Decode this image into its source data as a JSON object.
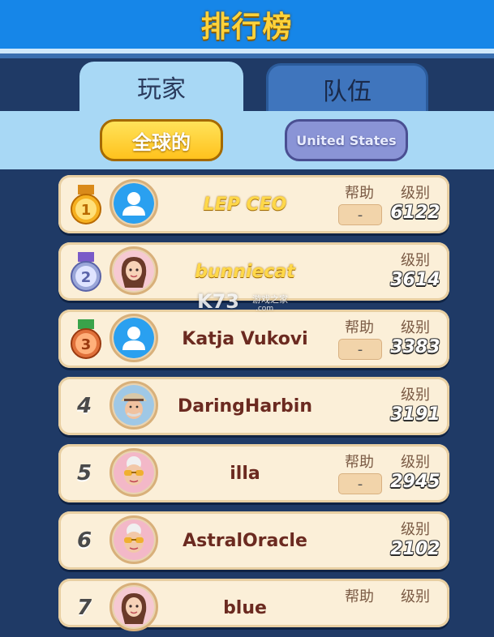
{
  "header": {
    "title": "排行榜"
  },
  "tabs": [
    {
      "label": "玩家",
      "active": true
    },
    {
      "label": "队伍",
      "active": false
    }
  ],
  "filters": {
    "global_label": "全球的",
    "country_label": "United States"
  },
  "columns": {
    "help": "帮助",
    "level": "级别"
  },
  "rows": [
    {
      "rank": "1",
      "medal": "gold",
      "avatar": "default-avatar",
      "name": "LEP CEO",
      "name_style": "gold",
      "help": "-",
      "show_help": true,
      "level": "6122"
    },
    {
      "rank": "2",
      "medal": "silver",
      "avatar": "woman-avatar",
      "name": "bunniecat",
      "name_style": "gold",
      "help": "",
      "show_help": false,
      "level": "3614"
    },
    {
      "rank": "3",
      "medal": "bronze",
      "avatar": "default-avatar",
      "name": "Katja Vukovi",
      "name_style": "normal",
      "help": "-",
      "show_help": true,
      "level": "3383"
    },
    {
      "rank": "4",
      "medal": "",
      "avatar": "old-man-hat-avatar",
      "name": "DaringHarbin",
      "name_style": "normal",
      "help": "",
      "show_help": false,
      "level": "3191"
    },
    {
      "rank": "5",
      "medal": "",
      "avatar": "grandma-sunglasses-avatar",
      "name": "illa",
      "name_style": "normal",
      "help": "-",
      "show_help": true,
      "level": "2945"
    },
    {
      "rank": "6",
      "medal": "",
      "avatar": "grandma-sunglasses-avatar",
      "name": "AstralOracle",
      "name_style": "normal",
      "help": "",
      "show_help": false,
      "level": "2102"
    },
    {
      "rank": "7",
      "medal": "",
      "avatar": "woman-avatar",
      "name": "blue",
      "name_style": "normal",
      "help": "",
      "show_help": true,
      "level": ""
    }
  ],
  "watermark": {
    "logo": "K73",
    "cn": "游戏之家",
    "url": ".com"
  },
  "colors": {
    "gold": "#ffd23a",
    "header_blue": "#1686e8",
    "row_bg": "#fbefd8",
    "name_red": "#6b2a20"
  }
}
